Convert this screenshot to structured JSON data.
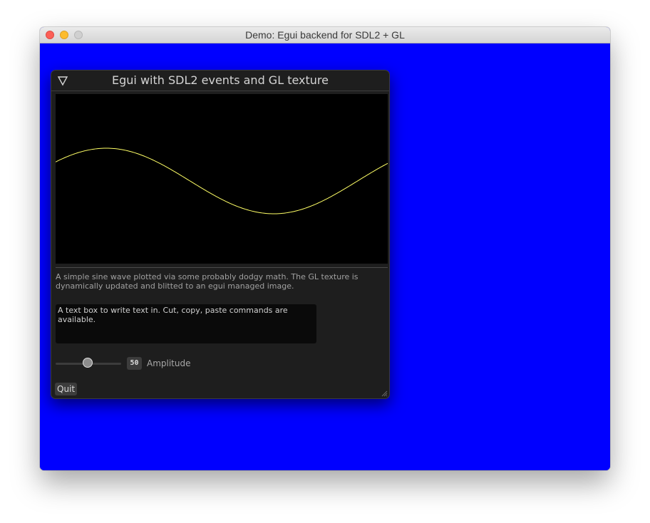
{
  "os_window": {
    "title": "Demo: Egui backend for SDL2 + GL",
    "background_color": "#0000ff"
  },
  "egui_window": {
    "title": "Egui with SDL2 events and GL texture",
    "collapse_icon": "triangle-down-icon",
    "plot": {
      "background_color": "#000000",
      "line_color": "#ffff66",
      "amplitude": 50
    },
    "description": "A simple sine wave plotted via some probably dodgy math. The GL texture is dynamically updated and blitted to an egui managed image.",
    "textbox": {
      "value": "A text box to write text in. Cut, copy, paste commands are available."
    },
    "slider": {
      "value": "50",
      "label": "Amplitude",
      "fraction": 0.5
    },
    "quit_label": "Quit"
  }
}
